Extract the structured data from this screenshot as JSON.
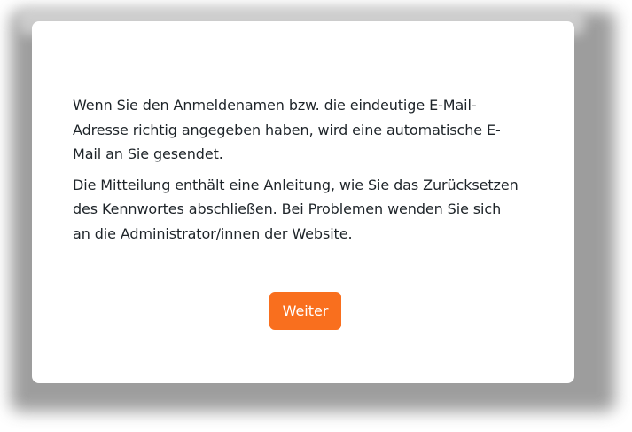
{
  "dialog": {
    "paragraphs": [
      "Wenn Sie den Anmeldenamen bzw. die eindeutige E-Mail-Adresse richtig angegeben haben, wird eine automatische E-Mail an Sie gesendet.",
      "Die Mitteilung enthält eine Anleitung, wie Sie das Zurücksetzen des Kennwortes abschließen. Bei Problemen wenden Sie sich an die Administrator/innen der Website."
    ],
    "continue_label": "Weiter"
  },
  "colors": {
    "accent": "#f96f1e",
    "text": "#1e2429",
    "card": "#ffffff",
    "shadow": "#8d8d8d"
  }
}
